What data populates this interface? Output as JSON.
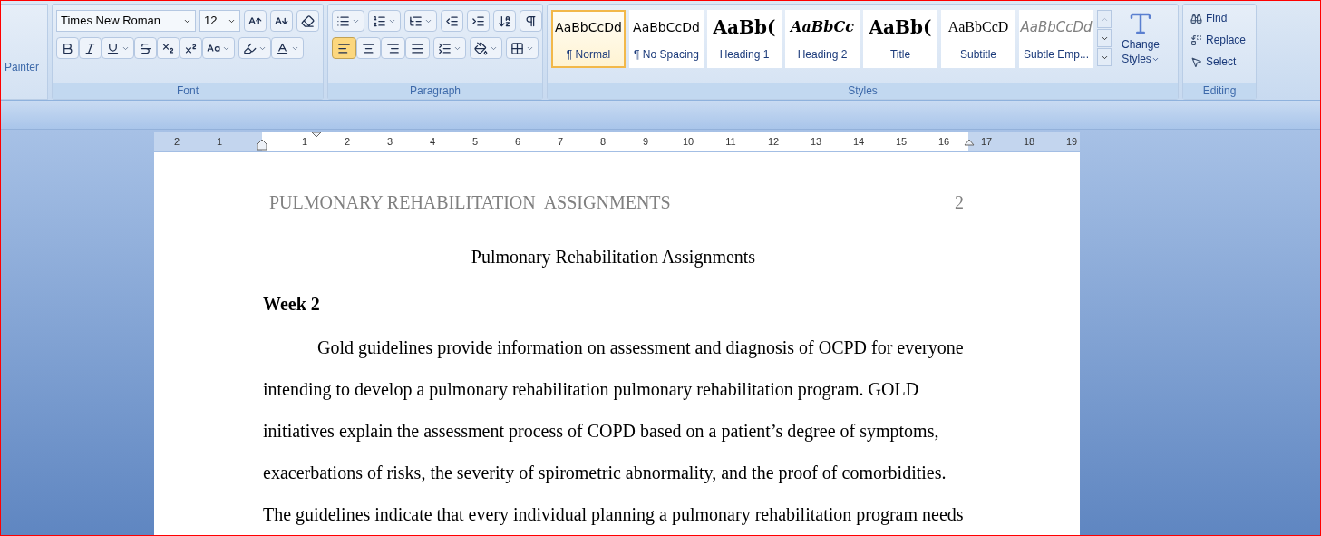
{
  "clipboard": {
    "label": "Painter"
  },
  "font": {
    "group_label": "Font",
    "name": "Times New Roman",
    "size": "12"
  },
  "paragraph": {
    "group_label": "Paragraph",
    "alignment": [
      {
        "kind": "left",
        "selected": true
      },
      {
        "kind": "center",
        "selected": false
      },
      {
        "kind": "right",
        "selected": false
      },
      {
        "kind": "justify",
        "selected": false
      }
    ]
  },
  "styles": {
    "group_label": "Styles",
    "change_styles": [
      "Change",
      "Styles"
    ],
    "items": [
      {
        "preview": "AaBbCcDd",
        "label": "¶ Normal",
        "kind": "normal",
        "selected": true
      },
      {
        "preview": "AaBbCcDd",
        "label": "¶ No Spacing",
        "kind": "normal",
        "selected": false
      },
      {
        "preview": "AaBb(",
        "label": "Heading 1",
        "kind": "heading1",
        "selected": false
      },
      {
        "preview": "AaBbCc",
        "label": "Heading 2",
        "kind": "heading2",
        "selected": false
      },
      {
        "preview": "AaBb(",
        "label": "Title",
        "kind": "title",
        "selected": false
      },
      {
        "preview": "AaBbCcD",
        "label": "Subtitle",
        "kind": "subtitle",
        "selected": false
      },
      {
        "preview": "AaBbCcDd",
        "label": "Subtle Emp...",
        "kind": "subtle",
        "selected": false
      }
    ]
  },
  "editing": {
    "group_label": "Editing",
    "items": [
      {
        "label": "Find",
        "kind": "find"
      },
      {
        "label": "Replace",
        "kind": "replace"
      },
      {
        "label": "Select",
        "kind": "select"
      }
    ]
  },
  "ruler": {
    "left_margin_labels": [
      "2",
      "1"
    ],
    "labels": [
      "1",
      "2",
      "3",
      "4",
      "5",
      "6",
      "7",
      "8",
      "9",
      "10",
      "11",
      "12",
      "13",
      "14",
      "15",
      "16",
      "17",
      "18",
      "19"
    ]
  },
  "document": {
    "header": "PULMONARY REHABILITATION  ASSIGNMENTS",
    "page_number": "2",
    "title": "Pulmonary Rehabilitation Assignments",
    "heading": "Week 2",
    "paragraph": "Gold guidelines provide information on assessment and diagnosis of OCPD for everyone intending to develop a pulmonary rehabilitation pulmonary rehabilitation program. GOLD initiatives explain the assessment process of COPD based on a patient’s degree of symptoms, exacerbations of risks, the severity of spirometric abnormality, and the proof of comorbidities. The guidelines indicate that every individual planning a pulmonary rehabilitation program needs"
  }
}
